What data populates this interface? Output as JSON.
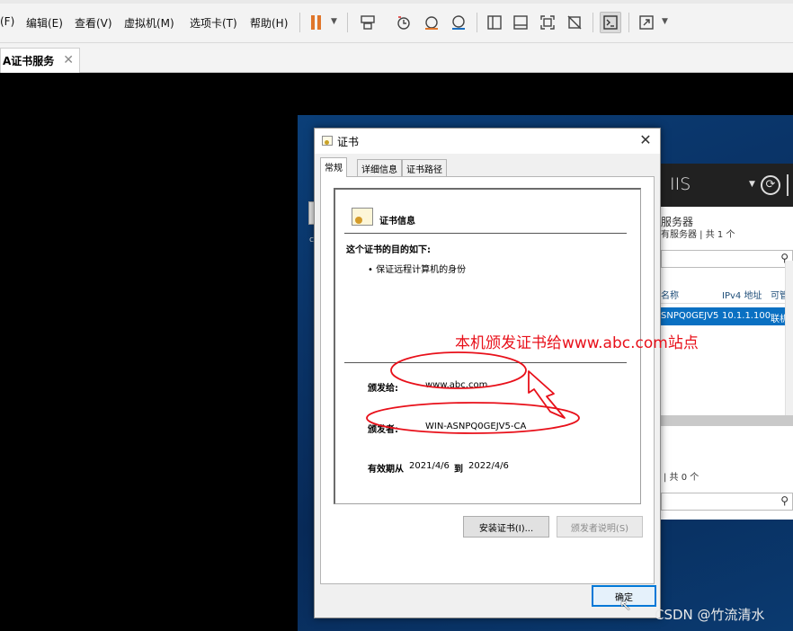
{
  "menu": {
    "file_fragment": "(F)",
    "items": [
      "编辑(E)",
      "查看(V)",
      "虚拟机(M)",
      "选项卡(T)",
      "帮助(H)"
    ]
  },
  "toolbar": {
    "icons": [
      "pause-icon",
      "send-ctrl-alt-del-icon",
      "snapshot-icon",
      "revert-snapshot-icon",
      "snapshot-manager-icon",
      "library-view-icon",
      "single-window-icon",
      "fullscreen-icon",
      "unity-icon",
      "console-view-icon",
      "stretch-guest-icon"
    ],
    "pause_color": "#e0762b"
  },
  "tab": {
    "label": "A证书服务",
    "close": "✕"
  },
  "server_manager": {
    "header_title": "IIS",
    "section_title": "服务器",
    "subtitle": "有服务器 | 共 1 个",
    "columns": [
      "名称",
      "IPv4 地址",
      "可管理"
    ],
    "row": {
      "name": "SNPQ0GEJV5",
      "ip": "10.1.1.100",
      "status": "联机"
    },
    "count_2": "| 共 0 个"
  },
  "dialog": {
    "title": "证书",
    "close": "✕",
    "tabs": [
      "常规",
      "详细信息",
      "证书路径"
    ],
    "selected_tab": 0,
    "info_title": "证书信息",
    "purpose_heading": "这个证书的目的如下:",
    "purpose_item": "• 保证远程计算机的身份",
    "issued_to_label": "颁发给:",
    "issued_to_value": "www.abc.com",
    "issued_by_label": "颁发者:",
    "issued_by_value": "WIN-ASNPQ0GEJV5-CA",
    "valid_label": "有效期从",
    "valid_from": "2021/4/6",
    "valid_to_word": "到",
    "valid_to": "2022/4/6",
    "install_button": "安装证书(I)...",
    "issuer_statement_button": "颁发者说明(S)",
    "ok_button": "确定"
  },
  "annotation": {
    "text": "本机颁发证书给www.abc.com站点",
    "color": "#e8101a"
  },
  "watermark": "CSDN @竹流清水"
}
